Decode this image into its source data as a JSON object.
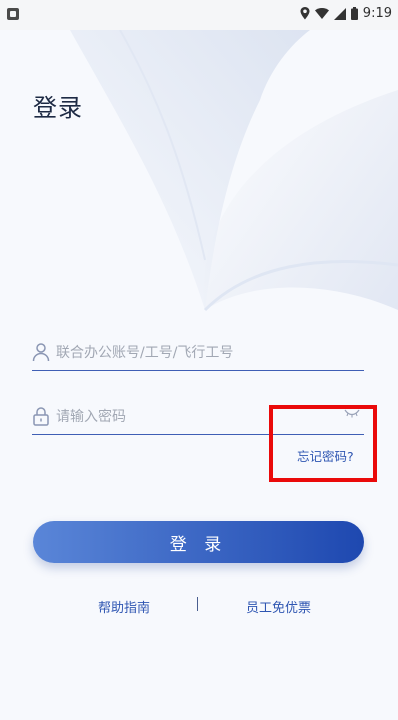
{
  "status_bar": {
    "time": "9:19"
  },
  "page": {
    "title": "登录",
    "account_placeholder": "联合办公账号/工号/飞行工号",
    "password_placeholder": "请输入密码",
    "forgot_password": "忘记密码?",
    "login_button": "登 录",
    "help_link": "帮助指南",
    "employee_perk_link": "员工免优票"
  },
  "colors": {
    "accent": "#2f56b2",
    "button_gradient_start": "#5a86d8",
    "button_gradient_end": "#1e48b0",
    "highlight_box": "#ea0a0a"
  }
}
